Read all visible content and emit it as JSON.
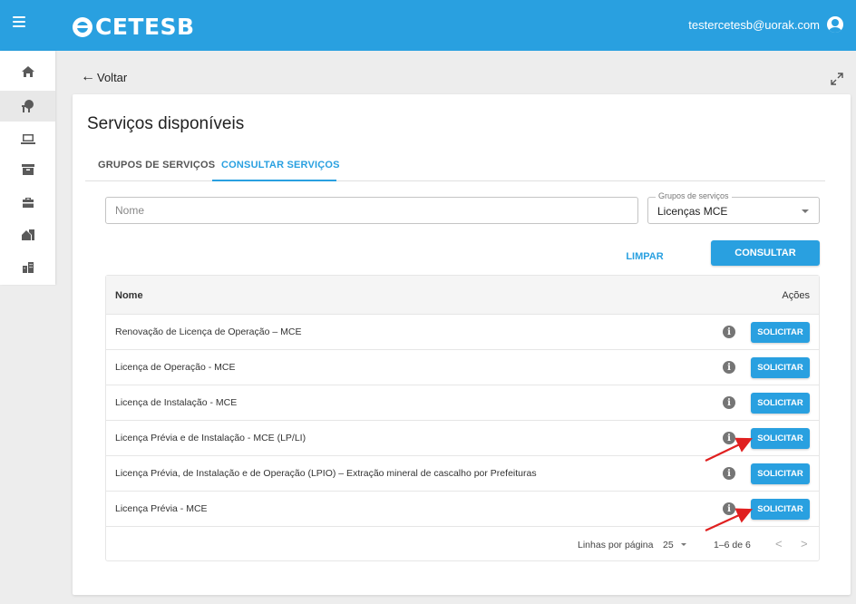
{
  "header": {
    "brand": "CETESB",
    "user_email": "testercetesb@uorak.com"
  },
  "nav": {
    "items": [
      "home-icon",
      "tree-icon",
      "laptop-icon",
      "archive-icon",
      "briefcase-icon",
      "building-icon",
      "city-icon"
    ]
  },
  "back_label": "Voltar",
  "page": {
    "title": "Serviços disponíveis",
    "tabs": [
      {
        "label": "GRUPOS DE SERVIÇOS"
      },
      {
        "label": "CONSULTAR SERVIÇOS"
      }
    ]
  },
  "filters": {
    "name_placeholder": "Nome",
    "group_label": "Grupos de serviços",
    "group_value": "Licenças MCE",
    "clear_label": "LIMPAR",
    "search_label": "CONSULTAR"
  },
  "table": {
    "col_name": "Nome",
    "col_actions": "Ações",
    "action_label": "SOLICITAR",
    "rows": [
      {
        "name": "Renovação de Licença de Operação – MCE"
      },
      {
        "name": "Licença de Operação - MCE"
      },
      {
        "name": "Licença de Instalação - MCE"
      },
      {
        "name": "Licença Prévia e de Instalação - MCE (LP/LI)"
      },
      {
        "name": "Licença Prévia, de Instalação e de Operação (LPIO) – Extração mineral de cascalho por Prefeituras"
      },
      {
        "name": "Licença Prévia - MCE"
      }
    ]
  },
  "pagination": {
    "rows_per_page_label": "Linhas por página",
    "rows_per_page_value": "25",
    "range": "1–6 de 6"
  },
  "colors": {
    "primary": "#29a0e0",
    "annotation_arrow": "#e02020"
  }
}
